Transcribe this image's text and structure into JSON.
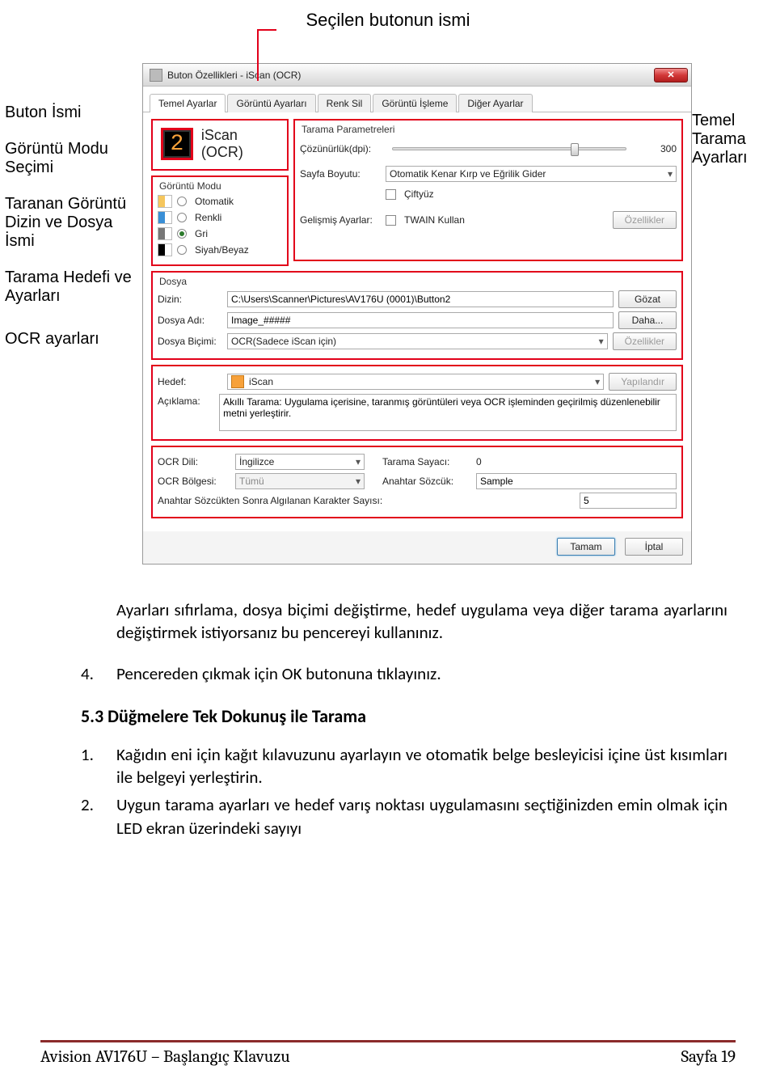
{
  "annotations": {
    "top": "Seçilen butonun ismi",
    "left": [
      "Buton İsmi",
      "Görüntü Modu Seçimi",
      "Taranan Görüntü Dizin ve Dosya İsmi",
      "Tarama Hedefi ve Ayarları",
      "OCR ayarları"
    ],
    "right": "Temel Tarama Ayarları"
  },
  "window": {
    "title": "Buton Özellikleri - iScan (OCR)",
    "tabs": [
      "Temel Ayarlar",
      "Görüntü Ayarları",
      "Renk Sil",
      "Görüntü İşleme",
      "Diğer Ayarlar"
    ],
    "button_name": "iScan (OCR)",
    "image_mode": {
      "label": "Görüntü Modu",
      "options": [
        "Otomatik",
        "Renkli",
        "Gri",
        "Siyah/Beyaz"
      ],
      "selected": "Gri"
    },
    "scan_params": {
      "group_label": "Tarama Parametreleri",
      "resolution_label": "Çözünürlük(dpi):",
      "resolution_value": "300",
      "page_size_label": "Sayfa Boyutu:",
      "page_size_value": "Otomatik Kenar Kırp ve Eğrilik Gider",
      "duplex_label": "Çiftyüz",
      "advanced_label": "Gelişmiş Ayarlar:",
      "twain_label": "TWAIN Kullan",
      "properties_btn": "Özellikler"
    },
    "file": {
      "group_label": "Dosya",
      "dir_label": "Dizin:",
      "dir_value": "C:\\Users\\Scanner\\Pictures\\AV176U (0001)\\Button2",
      "browse_btn": "Gözat",
      "name_label": "Dosya Adı:",
      "name_value": "Image_#####",
      "more_btn": "Daha...",
      "format_label": "Dosya Biçimi:",
      "format_value": "OCR(Sadece iScan için)",
      "format_props_btn": "Özellikler"
    },
    "target": {
      "hedef_label": "Hedef:",
      "hedef_value": "iScan",
      "configure_btn": "Yapılandır",
      "desc_label": "Açıklama:",
      "desc_value": "Akıllı Tarama: Uygulama içerisine, taranmış görüntüleri veya OCR işleminden geçirilmiş düzenlenebilir metni yerleştirir."
    },
    "ocr": {
      "lang_label": "OCR Dili:",
      "lang_value": "İngilizce",
      "zone_label": "OCR Bölgesi:",
      "zone_value": "Tümü",
      "count_label": "Tarama Sayacı:",
      "count_value": "0",
      "keyword_label": "Anahtar Sözcük:",
      "keyword_value": "Sample",
      "chars_after_label": "Anahtar Sözcükten Sonra Algılanan Karakter Sayısı:",
      "chars_after_value": "5"
    },
    "footer": {
      "ok": "Tamam",
      "cancel": "İptal"
    }
  },
  "body": {
    "para": "Ayarları sıfırlama, dosya biçimi değiştirme, hedef uygulama veya diğer tarama ayarlarını değiştirmek istiyorsanız bu pencereyi kullanınız.",
    "item4_num": "4.",
    "item4": "Pencereden çıkmak için OK butonuna tıklayınız.",
    "heading": "5.3 Düğmelere Tek Dokunuş ile Tarama",
    "list": [
      {
        "num": "1.",
        "text": "Kağıdın eni için kağıt kılavuzunu ayarlayın ve otomatik belge besleyicisi içine üst kısımları ile belgeyi yerleştirin."
      },
      {
        "num": "2.",
        "text": "Uygun tarama ayarları ve hedef varış noktası uygulamasını seçtiğinizden emin olmak için LED ekran üzerindeki sayıyı"
      }
    ]
  },
  "footer": {
    "left": "Avision AV176U – Başlangıç Klavuzu",
    "right": "Sayfa 19"
  }
}
